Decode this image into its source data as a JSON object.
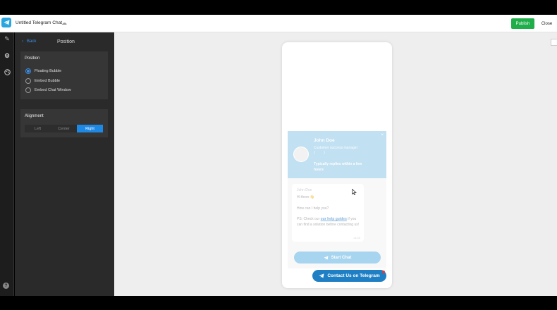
{
  "header": {
    "title": "Untitled Telegram Chat",
    "publish_label": "Publish",
    "close_label": "Close"
  },
  "rail": {
    "icons": [
      "pencil-icon",
      "gear-icon",
      "palette-icon"
    ],
    "help_label": "?"
  },
  "panel": {
    "back_label": "Back",
    "title": "Position",
    "position_section": {
      "label": "Position",
      "options": [
        "Floating Bubble",
        "Embed Bubble",
        "Embed Chat Window"
      ],
      "selected": "Floating Bubble"
    },
    "alignment_section": {
      "label": "Alignment",
      "options": [
        "Left",
        "Center",
        "Right"
      ],
      "selected": "Right"
    }
  },
  "widget": {
    "agent_name": "John Doe",
    "agent_role": "Customer success manager",
    "agent_sub": "(         )",
    "reply_time": "Typically replies within a few hours",
    "close_glyph": "×",
    "message": {
      "sender": "John Doe",
      "greeting": "Hi there 👋",
      "help": "How can I help you?",
      "ps_prefix": "PS: Check our ",
      "ps_link": "our help guides",
      "ps_suffix": " if you can find a solution before contacting us!",
      "time": "14:05"
    },
    "start_chat_label": "Start Chat",
    "contact_label": "Contact Us on Telegram"
  },
  "colors": {
    "accent": "#1e88e5",
    "publish": "#1fae4a",
    "telegram": "#2aa6df",
    "contact": "#1e7fc4"
  }
}
